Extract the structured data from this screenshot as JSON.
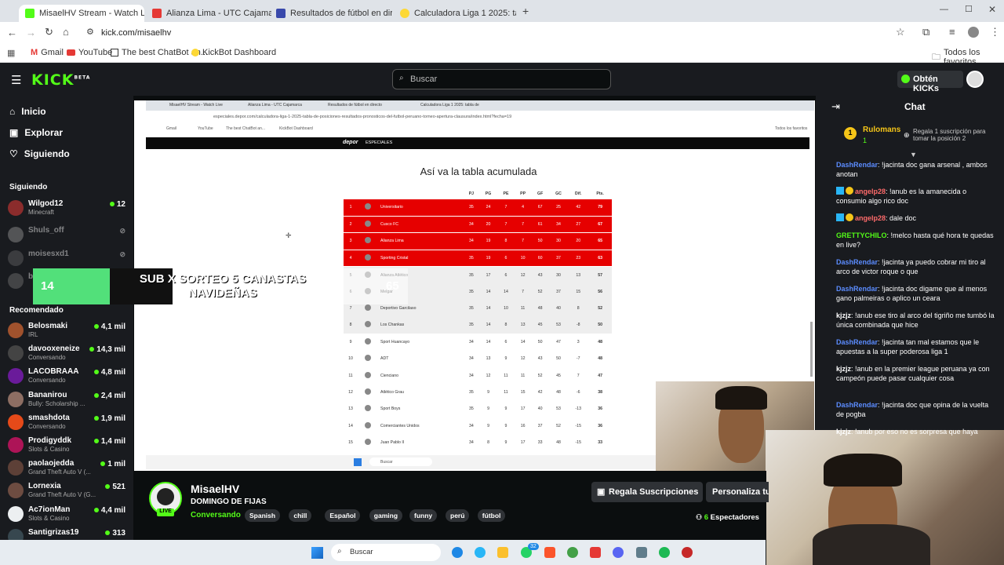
{
  "browser": {
    "tabs": [
      {
        "title": "MisaelHV Stream - Watch Live",
        "active": true
      },
      {
        "title": "Alianza Lima - UTC Cajamarca"
      },
      {
        "title": "Resultados de fútbol en directo"
      },
      {
        "title": "Calculadora Liga 1 2025: tabla de"
      }
    ],
    "url": "kick.com/misaelhv",
    "bookmarks": [
      "Gmail",
      "YouTube",
      "The best ChatBot an...",
      "KickBot Dashboard"
    ],
    "all_favorites": "Todos los favoritos"
  },
  "kick": {
    "logo": "KICK",
    "logo_badge": "BETA",
    "search_placeholder": "Buscar",
    "get_kicks": "Obtén KICKs"
  },
  "sidebar": {
    "nav": [
      {
        "label": "Inicio",
        "icon": "home-icon"
      },
      {
        "label": "Explorar",
        "icon": "explore-icon"
      },
      {
        "label": "Siguiendo",
        "icon": "heart-icon"
      }
    ],
    "following_header": "Siguiendo",
    "following": [
      {
        "name": "Wilgod12",
        "category": "Minecraft",
        "viewers": "12",
        "live": true
      },
      {
        "name": "Shuls_off",
        "category": "",
        "viewers": "",
        "live": false
      },
      {
        "name": "moisesxd1",
        "category": "",
        "viewers": "",
        "live": false
      },
      {
        "name": "b",
        "category": "",
        "viewers": "",
        "live": false
      }
    ],
    "recommended_header": "Recomendado",
    "recommended": [
      {
        "name": "Belosmaki",
        "category": "IRL",
        "viewers": "4,1 mil"
      },
      {
        "name": "davooxeneize",
        "category": "Conversando",
        "viewers": "14,3 mil"
      },
      {
        "name": "LACOBRAAA",
        "category": "Conversando",
        "viewers": "4,8 mil"
      },
      {
        "name": "Bananirou",
        "category": "Bully: Scholarship ...",
        "viewers": "2,4 mil"
      },
      {
        "name": "smashdota",
        "category": "Conversando",
        "viewers": "1,9 mil"
      },
      {
        "name": "Prodigyddk",
        "category": "Slots & Casino",
        "viewers": "1,4 mil"
      },
      {
        "name": "paolaojedda",
        "category": "Grand Theft Auto V (...",
        "viewers": "1 mil"
      },
      {
        "name": "Lornexia",
        "category": "Grand Theft Auto V (G...",
        "viewers": "521"
      },
      {
        "name": "Ac7ionMan",
        "category": "Slots & Casino",
        "viewers": "4,4 mil"
      },
      {
        "name": "Santigrizas19",
        "category": "",
        "viewers": "313"
      }
    ]
  },
  "stream": {
    "inner_url": "especiales.depor.com/calculadora-liga-1-2025-tabla-de-posiciones-resultados-pronosticos-del-futbol-peruano-torneo-apertura-clausura/index.html?fecha=19",
    "site": "depor",
    "site_section": "ESPECIALES",
    "table_title": "Así va la tabla acumulada",
    "headers": [
      "",
      "",
      "",
      "PJ",
      "PG",
      "PE",
      "PP",
      "GF",
      "GC",
      "Dif.",
      "Pts."
    ],
    "rows": [
      {
        "pos": "1",
        "team": "Universitario",
        "pj": "35",
        "pg": "24",
        "pe": "7",
        "pp": "4",
        "gf": "67",
        "gc": "25",
        "dif": "42",
        "pts": "79",
        "hl": "red"
      },
      {
        "pos": "2",
        "team": "Cusco FC",
        "pj": "34",
        "pg": "20",
        "pe": "7",
        "pp": "7",
        "gf": "61",
        "gc": "34",
        "dif": "27",
        "pts": "67",
        "hl": "red"
      },
      {
        "pos": "3",
        "team": "Alianza Lima",
        "pj": "34",
        "pg": "19",
        "pe": "8",
        "pp": "7",
        "gf": "50",
        "gc": "30",
        "dif": "20",
        "pts": "65",
        "hl": "red"
      },
      {
        "pos": "4",
        "team": "Sporting Cristal",
        "pj": "35",
        "pg": "19",
        "pe": "6",
        "pp": "10",
        "gf": "60",
        "gc": "37",
        "dif": "23",
        "pts": "63",
        "hl": "red"
      },
      {
        "pos": "5",
        "team": "Alianza Atlético",
        "pj": "35",
        "pg": "17",
        "pe": "6",
        "pp": "12",
        "gf": "43",
        "gc": "30",
        "dif": "13",
        "pts": "57",
        "hl": "grey"
      },
      {
        "pos": "6",
        "team": "Melgar",
        "pj": "35",
        "pg": "14",
        "pe": "14",
        "pp": "7",
        "gf": "52",
        "gc": "37",
        "dif": "15",
        "pts": "56",
        "hl": "grey"
      },
      {
        "pos": "7",
        "team": "Deportivo Garcilaso",
        "pj": "35",
        "pg": "14",
        "pe": "10",
        "pp": "11",
        "gf": "48",
        "gc": "40",
        "dif": "8",
        "pts": "52",
        "hl": "grey"
      },
      {
        "pos": "8",
        "team": "Los Chankas",
        "pj": "35",
        "pg": "14",
        "pe": "8",
        "pp": "13",
        "gf": "45",
        "gc": "53",
        "dif": "-8",
        "pts": "50",
        "hl": "grey"
      },
      {
        "pos": "9",
        "team": "Sport Huancayo",
        "pj": "34",
        "pg": "14",
        "pe": "6",
        "pp": "14",
        "gf": "50",
        "gc": "47",
        "dif": "3",
        "pts": "48",
        "hl": ""
      },
      {
        "pos": "10",
        "team": "ADT",
        "pj": "34",
        "pg": "13",
        "pe": "9",
        "pp": "12",
        "gf": "43",
        "gc": "50",
        "dif": "-7",
        "pts": "48",
        "hl": ""
      },
      {
        "pos": "11",
        "team": "Cienciano",
        "pj": "34",
        "pg": "12",
        "pe": "11",
        "pp": "11",
        "gf": "52",
        "gc": "45",
        "dif": "7",
        "pts": "47",
        "hl": ""
      },
      {
        "pos": "12",
        "team": "Atlético Grau",
        "pj": "35",
        "pg": "9",
        "pe": "11",
        "pp": "15",
        "gf": "42",
        "gc": "48",
        "dif": "-6",
        "pts": "38",
        "hl": ""
      },
      {
        "pos": "13",
        "team": "Sport Boys",
        "pj": "35",
        "pg": "9",
        "pe": "9",
        "pp": "17",
        "gf": "40",
        "gc": "53",
        "dif": "-13",
        "pts": "36",
        "hl": ""
      },
      {
        "pos": "14",
        "team": "Comerciantes Unidos",
        "pj": "34",
        "pg": "9",
        "pe": "9",
        "pp": "16",
        "gf": "37",
        "gc": "52",
        "dif": "-15",
        "pts": "36",
        "hl": ""
      },
      {
        "pos": "15",
        "team": "Juan Pablo II",
        "pj": "34",
        "pg": "8",
        "pe": "9",
        "pp": "17",
        "gf": "33",
        "gc": "48",
        "dif": "-15",
        "pts": "33",
        "hl": ""
      }
    ],
    "overlay": {
      "count": "14",
      "text": "SUB X SORTEO 5 CANASTAS NAVIDEÑAS",
      "ghost": "NASTAS\nNAVIDEÑAS",
      "score": "65"
    }
  },
  "channel": {
    "name": "MisaelHV",
    "title": "DOMINGO DE FIJAS",
    "category": "Conversando",
    "live_badge": "LIVE",
    "tags": [
      "Spanish",
      "chill",
      "Español",
      "gaming",
      "funny",
      "perú",
      "fútbol"
    ],
    "gift_button": "Regala Suscripciones",
    "customize_button": "Personaliza tu",
    "viewers": "6",
    "viewers_label": "Espectadores"
  },
  "chat": {
    "title": "Chat",
    "pinned": {
      "rank": "1",
      "user": "Rulomans",
      "gifts": "1",
      "text": "Regala 1 suscripción para tomar la posición 2"
    },
    "messages": [
      {
        "user": "DashRendar",
        "text": "!jacinta doc gana arsenal , ambos anotan",
        "color": "#5b8cff"
      },
      {
        "user": "angelp28",
        "text": "!anub es la amanecida o consumio algo rico doc",
        "color": "#ff6b6b",
        "badges": true
      },
      {
        "user": "angelp28",
        "text": "dale doc",
        "color": "#ff6b6b",
        "badges": true
      },
      {
        "user": "GRETTYCHILO",
        "text": "!melco hasta qué hora te quedas en live?",
        "color": "#53fc18"
      },
      {
        "user": "DashRendar",
        "text": "!jacinta ya puedo cobrar mi tiro al arco de victor roque o que",
        "color": "#5b8cff"
      },
      {
        "user": "DashRendar",
        "text": "!jacinta doc digame que al menos gano palmeiras o aplico un ceara",
        "color": "#5b8cff"
      },
      {
        "user": "kjzjz",
        "text": "!anub ese tiro al arco del tigriño me tumbó la única combinada que hice",
        "color": "#ffffff"
      },
      {
        "user": "DashRendar",
        "text": "!jacinta tan mal estamos que le apuestas a la super poderosa liga 1",
        "color": "#5b8cff"
      },
      {
        "user": "kjzjz",
        "text": "!anub en la premier league peruana ya con campeón puede pasar cualquier cosa",
        "color": "#ffffff"
      },
      {
        "user": "DashRendar",
        "text": "!jacinta doc que opina de la vuelta de pogba",
        "color": "#5b8cff"
      },
      {
        "user": "kjzjz",
        "text": "!anub por eso no es sorpresa que haya",
        "color": "#ffffff"
      }
    ]
  },
  "taskbar": {
    "search": "Buscar",
    "whatsapp_badge": "32"
  }
}
